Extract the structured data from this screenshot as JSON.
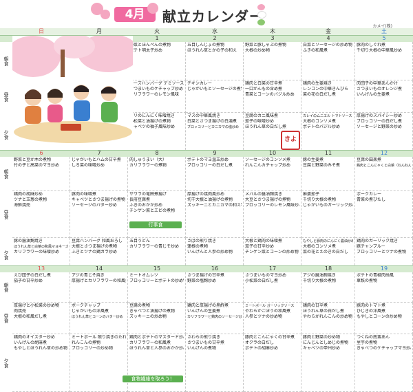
{
  "header": {
    "month": "4月",
    "title": "献立カレンダー",
    "unit": "カメイ(株)"
  },
  "weekdays": [
    "日",
    "月",
    "火",
    "水",
    "木",
    "金",
    "土"
  ],
  "meal_labels": [
    "朝食",
    "昼食",
    "夕食"
  ],
  "weeks": [
    {
      "dates": [
        "",
        "",
        "1",
        "2",
        "3",
        "4",
        "5"
      ],
      "meals": [
        [
          [],
          [],
          [
            "野菜とほんぺんの煮物",
            "ポテト明太子炒め"
          ],
          [
            "五目しんじょの煮物",
            "ほうれん草とかの子の和え"
          ],
          [
            "野菜と豚しゃぶの煮物",
            "大根の炒め物"
          ],
          [
            "白菜とソーセージの炒め物",
            "ふきの和風煮"
          ],
          [
            "豚肉のしぐれ煮",
            "千切り大根の中華風炒め"
          ]
        ],
        [
          [],
          [],
          [
            "チーズハンバーグ デミソース",
            "さつまいものケチャップ炒め",
            "カリフラワーのレモン風味"
          ],
          [
            "チキンカレー",
            "じゃがいもとソーセージの煮物"
          ],
          [
            "鶏肉と白菜の甘辛煮",
            "一口がんもの含め煮",
            "青菜とコーンのバジル炒め"
          ],
          [
            "鶏肉の生姜焼き",
            "レンコンの中華きんぴら",
            "菜の花の白だし煮"
          ],
          [
            "肉団子の中華あんかけ",
            "さつまいものオレンジ煮",
            "いんげんの生姜煮"
          ]
        ],
        [
          [],
          [],
          [
            "ブリのにんにく味噌焼き",
            "小松菜と油揚げの煮物",
            "キャベツの柚子風味炒め"
          ],
          [
            "マスの中華風焼き",
            "白菜とさつま揚げの白湯煮",
            "ブロッコリーとカニカマの塩炒め"
          ],
          [
            "豆腐のカニ風味煮",
            "茄子の味噌炒め",
            "ほうれん草の白だし煮"
          ],
          [
            "カレイのムニエル トマトソース",
            "大根のコンソメ煮",
            "ポテトのバジル炒め"
          ],
          [
            "厚揚げのスパイシー炒め",
            "ブロッコリーの白だし煮",
            "ソーセージと野菜の炒め"
          ]
        ]
      ]
    },
    {
      "dates": [
        "6",
        "7",
        "8",
        "9",
        "10",
        "11",
        "12"
      ],
      "meals": [
        [
          [
            "野菜と豆か木の煮物",
            "竹の子と高菜のマヨ炒め"
          ],
          [
            "じゃがいもとハムの甘辛煮",
            "しろ菜の味噌炒め"
          ],
          [
            "肉しゅうまい（大）",
            "カリフラワーの煮物"
          ],
          [
            "ポテトのマヨ温玉炒め",
            "ブロッコリーの白だし煮"
          ],
          [
            "ソーセージのコンソメ煮",
            "れんこんカチャップ炒め"
          ],
          [
            "豚の生姜煮",
            "豆腐と野菜のみそ煮"
          ],
          [
            "豆腐の田楽煮",
            "鶏肉とこんにゃくと白菜（ねんねん）"
          ]
        ],
        [
          [
            "鶏肉の胡麻炒め",
            "ツナと玉葱の煮物",
            "海鮮焼売"
          ],
          [
            "豚肉の味噌煮",
            "キャベツとさつま揚げの煮物",
            "ソーセージのバター炒め"
          ],
          [
            "サワラの竜田煮揚げ",
            "長府豆腐煮",
            "ふきのおかか炒め",
            "チンゲン菜とエビの煮物"
          ],
          [
            "厚揚げの焼肉風炒め",
            "切干大根と油揚げの煮物",
            "ズッキーニとカニカマの和え物"
          ],
          [
            "メバルの醤油麹焼き",
            "大豆とさつま揚げの煮物",
            "ブロッコリーのレモン風味炒め"
          ],
          [
            "麻婆茄子",
            "千切り大根の煮物",
            "じゃがいものガーリック炒め"
          ],
          [
            "ポークカレー",
            "青菜の煮びたし"
          ]
        ],
        [
          [
            "豚の醤油麹焼き",
            "ほうれん草と白菜の和風マヨネーズ炒め",
            "カリフラワーの味噌炒め"
          ],
          [
            "豆腐ハンバーグ 和風おろし",
            "大根とさつま揚げの煮物",
            "ふきとツナの鶏ガラ炒め"
          ],
          [
            "五目うどん",
            "カリフラワーの青じそ炒め"
          ],
          [
            "さばの煎り焼き",
            "蓮根の煮物",
            "いんげんと人参の炒め物"
          ],
          [
            "大根と鶏肉の味噌煮",
            "茄子の甘辛炒め",
            "チンゲン菜とコーンの炒め物"
          ],
          [
            "もやしと豚肉のにんにく醤油炒め",
            "大根のコンソメ煮",
            "菜の花とえのきの白だし"
          ],
          [
            "鶏肉のガーリック焼き",
            "豚チャンプルー",
            "ブロッコリーとツナの煮物"
          ]
        ]
      ]
    },
    {
      "dates": [
        "13",
        "14",
        "15",
        "16",
        "17",
        "18",
        "19"
      ],
      "meals": [
        [
          [
            "えび団子の白だし煮",
            "茄子の甘辛炒め"
          ],
          [
            "アジの青じそ焼き",
            "厚揚げとカリフラワーの和風煮"
          ],
          [
            "ミートオムレツ",
            "ブロッコリーとポテトの炒め物"
          ],
          [
            "さつま揚げの甘辛煮",
            "野菜の塩麹炒め"
          ],
          [
            "さつまいものマヨ炒め",
            "小松菜の白だし煮"
          ],
          [
            "アジの醤油麹焼き",
            "千切り大根の煮物"
          ],
          [
            "ポテトの青椒肉絲風",
            "車麸の煮物"
          ]
        ],
        [
          [
            "厚揚げと小松菜の炒め物",
            "肉焼売",
            "大根の和風だし煮"
          ],
          [
            "ポークチャップ",
            "じゃがいもの洋風煮",
            "ほうれん草とコーンのバター炒め"
          ],
          [
            "豆腐の煮物",
            "きゃべつと油揚げの煮物",
            "ズッキーニの炒め物"
          ],
          [
            "鶏肉と厚揚げの黒酢煮",
            "いんげんの生姜煮",
            "カリフラワーと鶏肉のソーセージ炒め"
          ],
          [
            "ミートボール ガーリックソース",
            "やわらかごぼうの和風煮",
            "人参とツナの炒め物"
          ],
          [
            "鶏肉の甘辛煮",
            "ほうれん草の白だし煮",
            "やわらかれんこんの炒め物"
          ],
          [
            "豚肉のトマト煮",
            "ひじきの洋風煮",
            "もやしとコーンの炒め物"
          ]
        ],
        [
          [
            "鶏肉のオイスター炒め",
            "いんげんの胡麻煮",
            "もやしとほうれん草の炒め物"
          ],
          [
            "ミートボール 照り焼きのたれ",
            "れんこんの煮物",
            "ブロッコリーの炒め物"
          ],
          [
            "鶏肉とポテトのマスタード炒め",
            "カリフラワーの和風煮",
            "ほうれん草と人参のおかか炒め"
          ],
          [
            "さわらの煎り焼き",
            "さつまいもの甘辛煮",
            "いんげんの煮物"
          ],
          [
            "豚肉とこんにゃくの甘辛煮",
            "オクラの白だし",
            "ポテトの胡麻炒め"
          ],
          [
            "豚肉と野菜の炒め物",
            "にんじんとしめじの煮物",
            "キャベツの甲州炒め"
          ],
          [
            "つくねの南蛮あん",
            "里芋の煮物",
            "きゃべつのケチャップマヨ炒め"
          ]
        ]
      ]
    }
  ],
  "badges": {
    "week2": "行事食",
    "week3": "食物繊維を取ろう！"
  },
  "stamp": "きよ",
  "colors": {
    "accent": "#f06aa0",
    "green": "#5bb050",
    "sunday": "#e05050",
    "saturday": "#3a7fd0",
    "header_bg": "#d6ebd0"
  }
}
